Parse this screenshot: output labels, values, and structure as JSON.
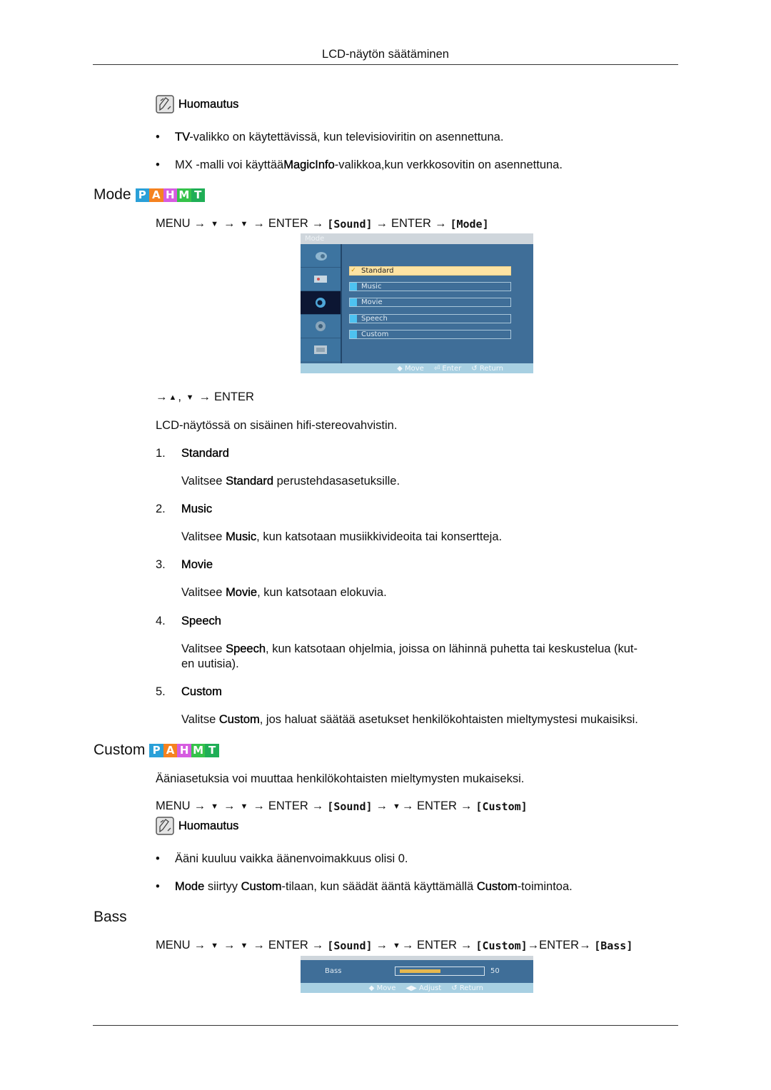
{
  "header": {
    "title": "LCD-näytön säätäminen"
  },
  "note1": {
    "label": "Huomautus",
    "bullets": [
      {
        "bold": "TV",
        "rest": "-valikko on käytettävissä, kun televisioviritin on asennettuna."
      },
      {
        "pre": "MX -malli voi käyttää",
        "bold": "MagicInfo",
        "rest": "-valikkoa,kun verkkosovitin on asennettuna."
      }
    ]
  },
  "badges": [
    {
      "letter": "P",
      "color": "#2aa0d8"
    },
    {
      "letter": "A",
      "color": "#f58220"
    },
    {
      "letter": "H",
      "color": "#d65ce0"
    },
    {
      "letter": "M",
      "color": "#35c24a"
    },
    {
      "letter": "T",
      "color": "#1fae56"
    }
  ],
  "mode": {
    "heading": "Mode",
    "path": {
      "menu": "MENU",
      "arrow": "→",
      "down": "▼",
      "enter": "ENTER",
      "sound": "[Sound]",
      "mode": "[Mode]"
    },
    "osd": {
      "title": "Mode",
      "options": [
        "Standard",
        "Music",
        "Movie",
        "Speech",
        "Custom"
      ],
      "selected": "Standard",
      "check": "✓",
      "footer": {
        "move": "Move",
        "enter": "Enter",
        "return": "Return"
      }
    },
    "nav_line": {
      "arrow": "→",
      "up": "▲",
      "comma": ",",
      "down": "▼",
      "enter": "ENTER"
    },
    "intro": "LCD-näytössä on sisäinen hifi-stereovahvistin.",
    "items": [
      {
        "num": "1.",
        "title": "Standard",
        "pre": "Valitsee ",
        "bold": "Standard",
        "rest": " perustehdasasetuksille."
      },
      {
        "num": "2.",
        "title": "Music",
        "pre": "Valitsee ",
        "bold": "Music",
        "rest": ", kun katsotaan musiikkivideoita tai konsertteja."
      },
      {
        "num": "3.",
        "title": "Movie",
        "pre": "Valitsee ",
        "bold": "Movie",
        "rest": ", kun katsotaan elokuvia."
      },
      {
        "num": "4.",
        "title": "Speech",
        "pre": "Valitsee ",
        "bold": "Speech",
        "rest": ", kun katsotaan ohjelmia, joissa on lähinnä puhetta tai keskustelua (kut-",
        "rest2": "en uutisia)."
      },
      {
        "num": "5.",
        "title": "Custom",
        "pre": "Valitse ",
        "bold": "Custom",
        "rest": ", jos haluat säätää asetukset henkilökohtaisten mieltymystesi mukaisiksi."
      }
    ]
  },
  "custom": {
    "heading": "Custom",
    "intro": "Ääniasetuksia voi muuttaa henkilökohtaisten mieltymysten mukaiseksi.",
    "path_end": "[Custom]",
    "note_label": "Huomautus",
    "bullets": [
      {
        "text": "Ääni kuuluu vaikka äänenvoimakkuus olisi 0."
      },
      {
        "b1": "Mode",
        "t1": " siirtyy ",
        "b2": "Custom",
        "t2": "-tilaan, kun säädät ääntä käyttämällä ",
        "b3": "Custom",
        "t3": "-toimintoa."
      }
    ]
  },
  "bass": {
    "heading": "Bass",
    "path_bass": "[Bass]",
    "osd": {
      "label": "Bass",
      "value": "50",
      "level_percent": 50,
      "footer": {
        "move": "Move",
        "adjust": "Adjust",
        "return": "Return"
      }
    }
  }
}
